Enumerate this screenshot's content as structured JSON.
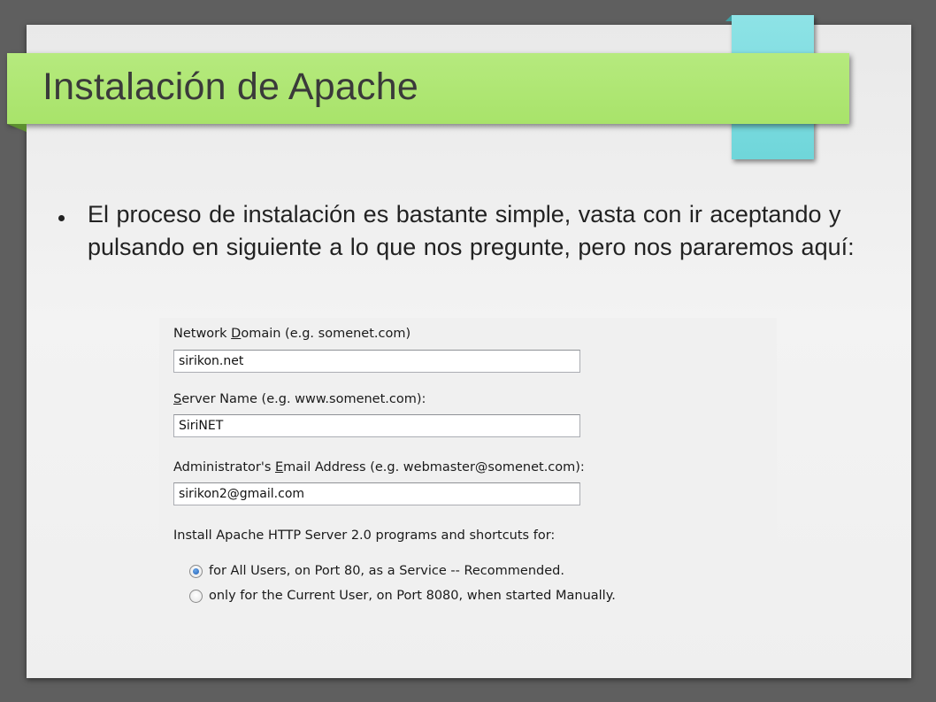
{
  "slide": {
    "title": "Instalación de Apache",
    "bullet": "El proceso de instalación es bastante simple, vasta con ir aceptando y pulsando en siguiente a lo que nos pregunte, pero nos pararemos aquí:"
  },
  "dialog": {
    "network_domain": {
      "label_pre": "Network ",
      "label_ul": "D",
      "label_post": "omain (e.g. somenet.com)",
      "value": "sirikon.net"
    },
    "server_name": {
      "label_pre": "",
      "label_ul": "S",
      "label_post": "erver Name (e.g. www.somenet.com):",
      "value": "SiriNET"
    },
    "admin_email": {
      "label_pre": "Administrator's ",
      "label_ul": "E",
      "label_post": "mail Address (e.g. webmaster@somenet.com):",
      "value": "sirikon2@gmail.com"
    },
    "install_for_label": "Install Apache HTTP Server 2.0 programs and shortcuts for:",
    "options": [
      {
        "label": "for All Users, on Port 80, as a Service -- Recommended.",
        "selected": true
      },
      {
        "label": "only for the Current User, on Port 8080, when started Manually.",
        "selected": false
      }
    ]
  },
  "colors": {
    "title_bar": "#b1e775",
    "accent_tab": "#7fdde0",
    "slide_bg": "#eeeeee",
    "frame_bg": "#5f5f5f"
  }
}
